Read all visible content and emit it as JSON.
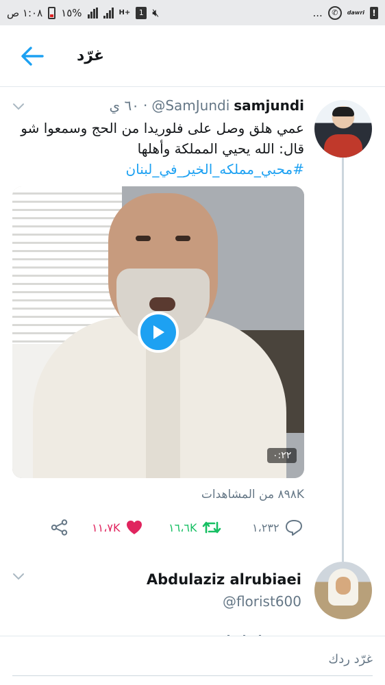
{
  "status_bar": {
    "time": "١:٠٨ ص",
    "battery_percent": "%١٥",
    "network": "H+",
    "sim": "1",
    "menu_dots": "...",
    "wa_label": "✆",
    "dawri_label": "dawri",
    "alert_label": "!"
  },
  "header": {
    "title": "غرّد",
    "back_icon": "arrow-left-icon",
    "accent_color": "#1da1f2"
  },
  "tweet": {
    "name": "samjundi",
    "handle": "@SamJundi",
    "time": "٦٠ ي",
    "separator": "·",
    "text_line1": "عمي هلق وصل على فلوريدا من الحج وسمعوا  شو",
    "text_line2": "قال:  الله يحيي المملكة وأهلها",
    "hashtag": "#محبي_مملكه_الخير_في_لبنان",
    "video_duration": "٠:٢٢",
    "views": "٨٩٨K من المشاهدات",
    "replies": "١،٢٣٢",
    "retweets": "١٦،٦K",
    "likes": "١١،٧K",
    "colors": {
      "retweet": "#17bf63",
      "like": "#e0245e",
      "muted": "#657786"
    }
  },
  "reply_tweet": {
    "name": "Abdulaziz alrubiaei",
    "handle": "@florist600"
  },
  "compose": {
    "placeholder": "غرّد ردك"
  }
}
